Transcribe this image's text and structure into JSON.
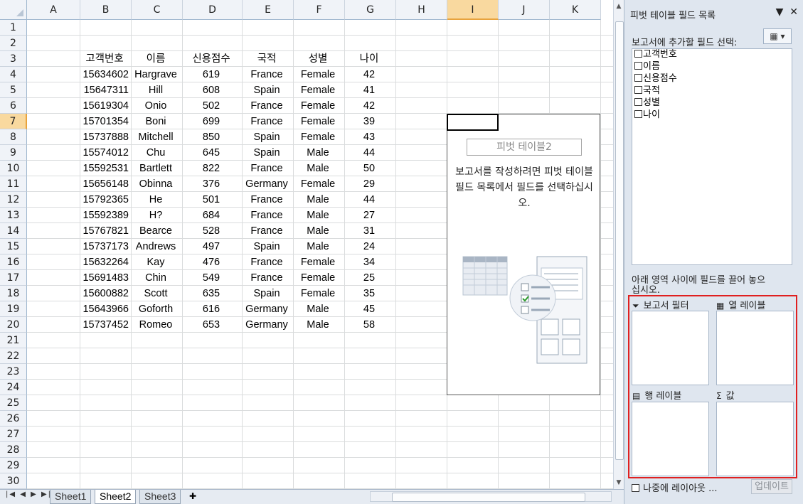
{
  "columns": [
    "A",
    "B",
    "C",
    "D",
    "E",
    "F",
    "G",
    "H",
    "I",
    "J",
    "K"
  ],
  "selected_column": "I",
  "rows": [
    "1",
    "2",
    "3",
    "4",
    "5",
    "6",
    "7",
    "8",
    "9",
    "10",
    "11",
    "12",
    "13",
    "14",
    "15",
    "16",
    "17",
    "18",
    "19",
    "20",
    "21",
    "22",
    "23",
    "24",
    "25",
    "26",
    "27",
    "28",
    "29",
    "30"
  ],
  "selected_row": "7",
  "table": {
    "headers": [
      "고객번호",
      "이름",
      "신용점수",
      "국적",
      "성별",
      "나이"
    ],
    "rows": [
      [
        "15634602",
        "Hargrave",
        "619",
        "France",
        "Female",
        "42"
      ],
      [
        "15647311",
        "Hill",
        "608",
        "Spain",
        "Female",
        "41"
      ],
      [
        "15619304",
        "Onio",
        "502",
        "France",
        "Female",
        "42"
      ],
      [
        "15701354",
        "Boni",
        "699",
        "France",
        "Female",
        "39"
      ],
      [
        "15737888",
        "Mitchell",
        "850",
        "Spain",
        "Female",
        "43"
      ],
      [
        "15574012",
        "Chu",
        "645",
        "Spain",
        "Male",
        "44"
      ],
      [
        "15592531",
        "Bartlett",
        "822",
        "France",
        "Male",
        "50"
      ],
      [
        "15656148",
        "Obinna",
        "376",
        "Germany",
        "Female",
        "29"
      ],
      [
        "15792365",
        "He",
        "501",
        "France",
        "Male",
        "44"
      ],
      [
        "15592389",
        "H?",
        "684",
        "France",
        "Male",
        "27"
      ],
      [
        "15767821",
        "Bearce",
        "528",
        "France",
        "Male",
        "31"
      ],
      [
        "15737173",
        "Andrews",
        "497",
        "Spain",
        "Male",
        "24"
      ],
      [
        "15632264",
        "Kay",
        "476",
        "France",
        "Female",
        "34"
      ],
      [
        "15691483",
        "Chin",
        "549",
        "France",
        "Female",
        "25"
      ],
      [
        "15600882",
        "Scott",
        "635",
        "Spain",
        "Female",
        "35"
      ],
      [
        "15643966",
        "Goforth",
        "616",
        "Germany",
        "Male",
        "45"
      ],
      [
        "15737452",
        "Romeo",
        "653",
        "Germany",
        "Male",
        "58"
      ]
    ]
  },
  "pivot_placeholder": {
    "title": "피벗 테이블2",
    "message": "보고서를 작성하려면 피벗 테이블 필드 목록에서 필드를 선택하십시오."
  },
  "sheet_tabs": [
    "Sheet1",
    "Sheet2",
    "Sheet3"
  ],
  "active_tab": "Sheet2",
  "field_panel": {
    "title": "피벗 테이블 필드 목록",
    "choose_label": "보고서에 추가할 필드 선택:",
    "fields": [
      "고객번호",
      "이름",
      "신용점수",
      "국적",
      "성별",
      "나이"
    ],
    "drag_label": "아래 영역 사이에 필드를 끌어 놓으십시오.",
    "areas": {
      "report_filter": "보고서 필터",
      "column_labels": "열 레이블",
      "row_labels": "행 레이블",
      "values": "값"
    },
    "defer_label": "나중에 레이아웃 ...",
    "update_button": "업데이트"
  },
  "colors": {
    "highlight": "#e02020",
    "selected_header": "#f9d99f"
  }
}
